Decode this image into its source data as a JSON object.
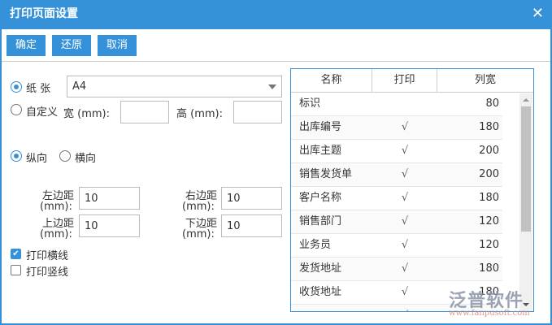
{
  "title": "打印页面设置",
  "toolbar": {
    "ok": "确定",
    "reset": "还原",
    "cancel": "取消"
  },
  "paper": {
    "label": "纸 张",
    "value": "A4",
    "custom_label": "自定义",
    "width_label": "宽 (mm):",
    "height_label": "高 (mm):",
    "width_value": "",
    "height_value": ""
  },
  "orientation": {
    "portrait": "纵向",
    "landscape": "横向"
  },
  "margins": {
    "left_label": "左边距",
    "right_label": "右边距",
    "top_label": "上边距",
    "bottom_label": "下边距",
    "unit": "(mm):",
    "left": "10",
    "right": "10",
    "top": "10",
    "bottom": "10"
  },
  "options": {
    "hlines": "打印横线",
    "vlines": "打印竖线"
  },
  "grid": {
    "headers": [
      "名称",
      "打印",
      "列宽"
    ],
    "rows": [
      {
        "name": "标识",
        "print": "",
        "width": "80"
      },
      {
        "name": "出库编号",
        "print": "√",
        "width": "180"
      },
      {
        "name": "出库主题",
        "print": "√",
        "width": "200"
      },
      {
        "name": "销售发货单",
        "print": "√",
        "width": "200"
      },
      {
        "name": "客户名称",
        "print": "√",
        "width": "180"
      },
      {
        "name": "销售部门",
        "print": "√",
        "width": "120"
      },
      {
        "name": "业务员",
        "print": "√",
        "width": "120"
      },
      {
        "name": "发货地址",
        "print": "√",
        "width": "180"
      },
      {
        "name": "收货地址",
        "print": "√",
        "width": "180"
      },
      {
        "name": "",
        "print": "√",
        "width": ""
      }
    ]
  },
  "watermark": {
    "name": "泛普软件",
    "url": "www.fanpusoft.com"
  }
}
